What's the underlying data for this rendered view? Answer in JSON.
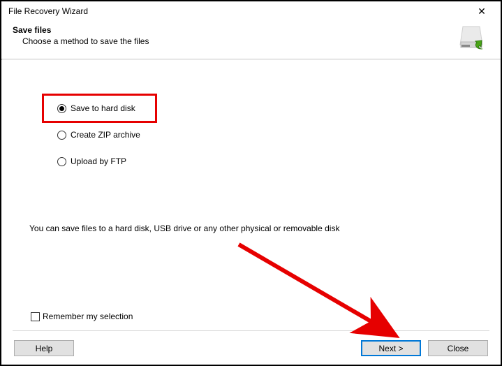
{
  "titlebar": {
    "title": "File Recovery Wizard",
    "close": "✕"
  },
  "header": {
    "title": "Save files",
    "subtitle": "Choose a method to save the files"
  },
  "options": [
    {
      "label": "Save to hard disk",
      "selected": true
    },
    {
      "label": "Create ZIP archive",
      "selected": false
    },
    {
      "label": "Upload by FTP",
      "selected": false
    }
  ],
  "description": "You can save files to a hard disk, USB drive or any other physical or removable disk",
  "remember": {
    "label": "Remember my selection",
    "checked": false
  },
  "buttons": {
    "help": "Help",
    "next": "Next >",
    "close": "Close"
  }
}
